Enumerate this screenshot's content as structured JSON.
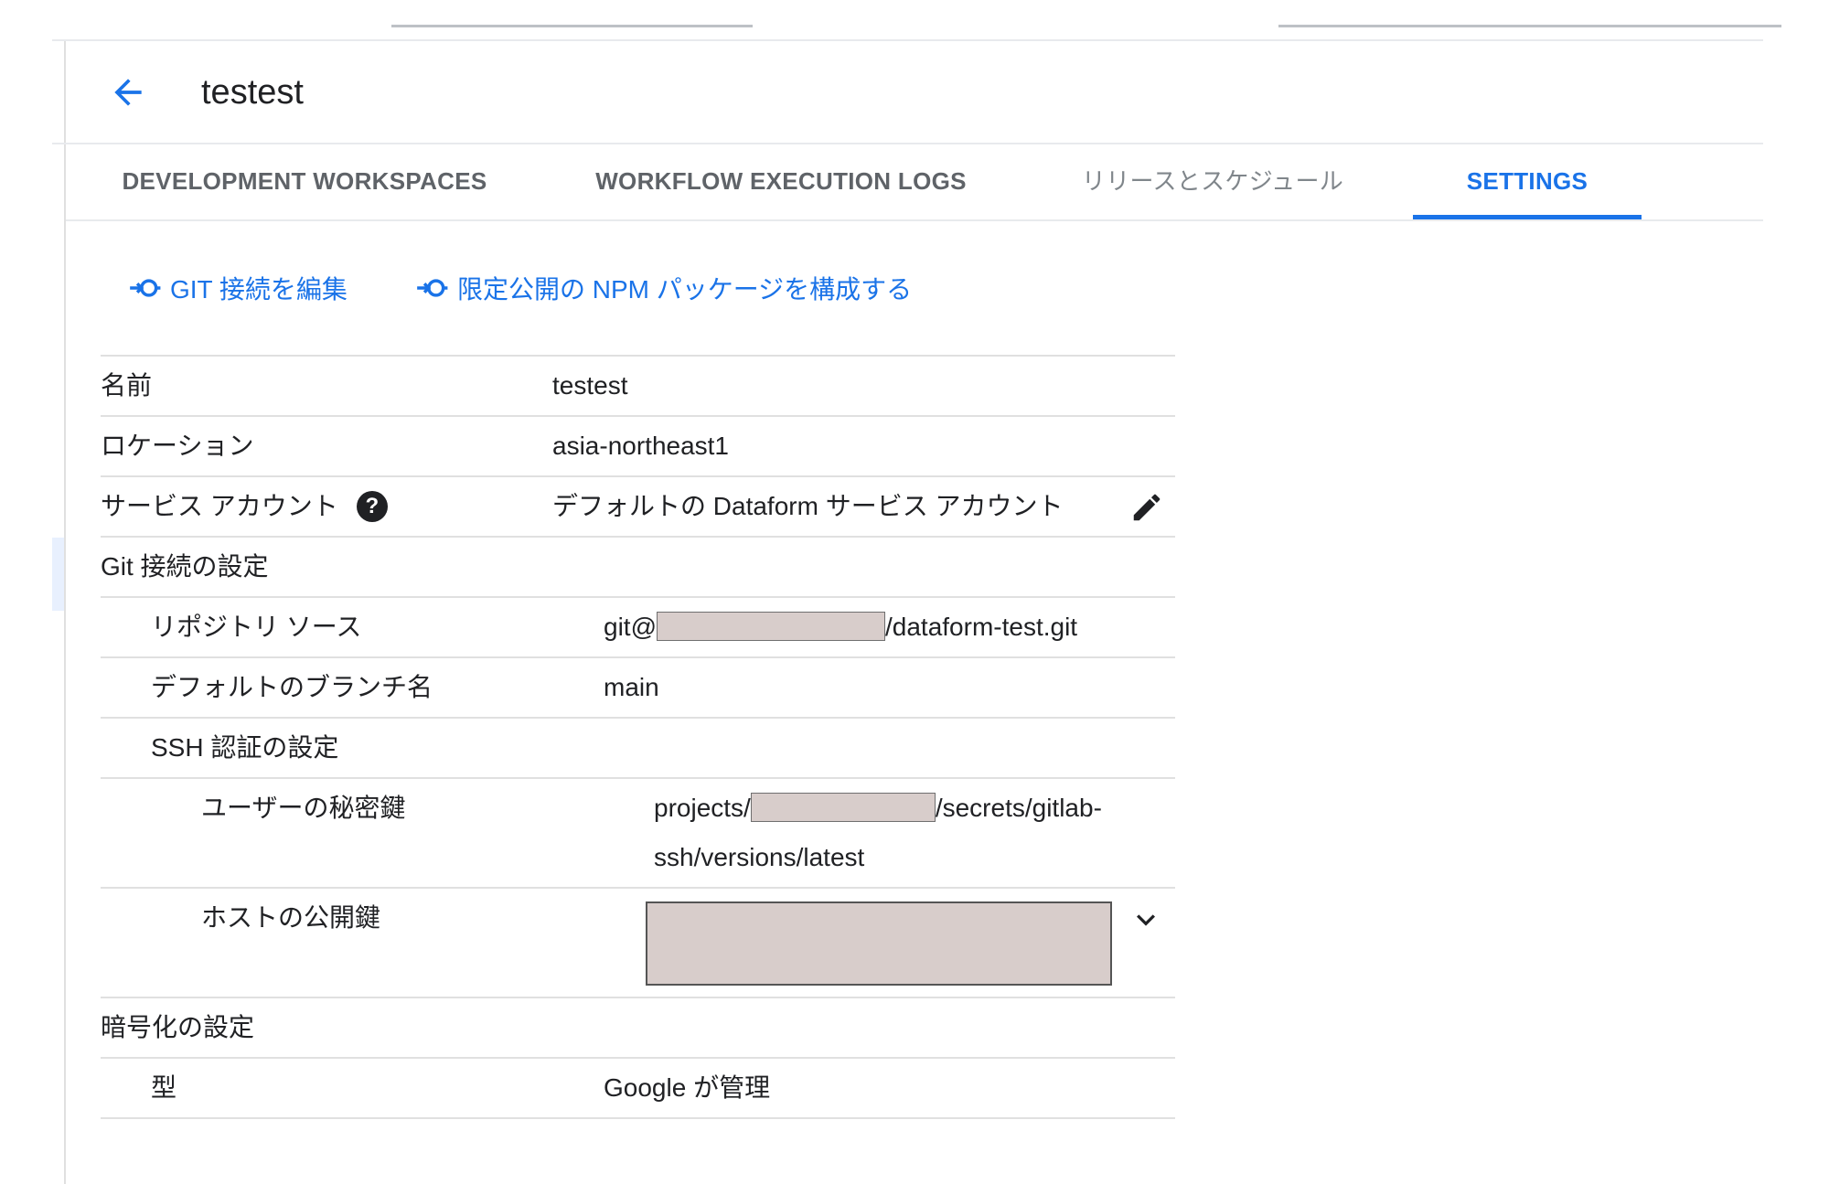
{
  "header": {
    "title": "testest",
    "back_icon": "arrow-left-icon"
  },
  "tabs": [
    {
      "label": "DEVELOPMENT WORKSPACES",
      "active": false
    },
    {
      "label": "WORKFLOW EXECUTION LOGS",
      "active": false
    },
    {
      "label": "リリースとスケジュール",
      "active": false
    },
    {
      "label": "SETTINGS",
      "active": true
    }
  ],
  "actions": {
    "edit_git": {
      "icon": "link-input-icon",
      "label": "GIT 接続を編集"
    },
    "configure_npm": {
      "icon": "link-input-icon",
      "label": "限定公開の NPM パッケージを構成する"
    }
  },
  "details": {
    "name": {
      "label": "名前",
      "value": "testest"
    },
    "location": {
      "label": "ロケーション",
      "value": "asia-northeast1"
    },
    "service_account": {
      "label": "サービス アカウント",
      "help_icon": "?",
      "value": "デフォルトの Dataform サービス アカウント",
      "edit_icon": "pencil-icon"
    },
    "git_settings": {
      "label": "Git 接続の設定"
    },
    "repository_source": {
      "label": "リポジトリ ソース",
      "value_prefix": "git@",
      "value_suffix": "/dataform-test.git"
    },
    "default_branch": {
      "label": "デフォルトのブランチ名",
      "value": "main"
    },
    "ssh_settings": {
      "label": "SSH 認証の設定"
    },
    "user_private_key": {
      "label": "ユーザーの秘密鍵",
      "value_prefix": "projects/",
      "value_suffix": "/secrets/gitlab-ssh/versions/latest"
    },
    "host_public_key": {
      "label": "ホストの公開鍵",
      "expand_icon": "chevron-down-icon"
    },
    "encryption_settings": {
      "label": "暗号化の設定"
    },
    "type": {
      "label": "型",
      "value": "Google が管理"
    }
  },
  "colors": {
    "accent": "#1a73e8",
    "redaction_fill": "#d8cdcb"
  }
}
